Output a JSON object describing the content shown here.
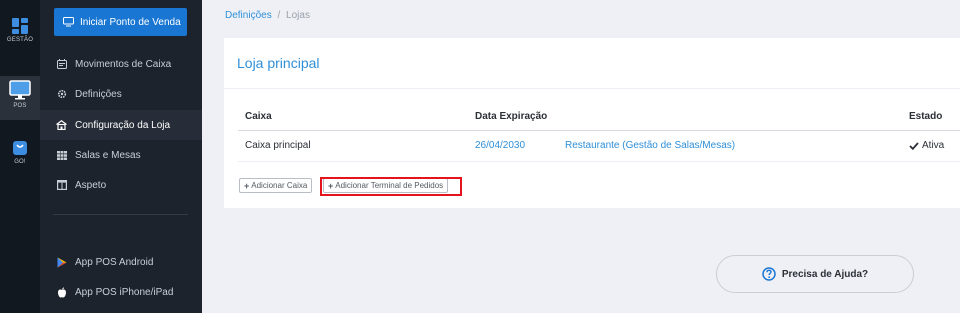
{
  "rail": {
    "items": [
      {
        "label": "GESTÃO",
        "icon": "dashboard-icon"
      },
      {
        "label": "POS",
        "icon": "monitor-icon"
      },
      {
        "label": "GO!",
        "icon": "shopping-bag-icon"
      }
    ]
  },
  "sidebar": {
    "pdv_button": "Iniciar Ponto de Venda",
    "items": [
      {
        "label": "Movimentos de Caixa",
        "icon": "cash-register-icon"
      },
      {
        "label": "Definições",
        "icon": "gear-icon"
      },
      {
        "label": "Configuração da Loja",
        "icon": "store-icon"
      },
      {
        "label": "Salas e Mesas",
        "icon": "grid-icon"
      },
      {
        "label": "Aspeto",
        "icon": "layout-icon"
      }
    ],
    "apps": [
      {
        "label": "App POS Android",
        "icon": "google-play-icon"
      },
      {
        "label": "App POS iPhone/iPad",
        "icon": "apple-icon"
      }
    ]
  },
  "breadcrumb": {
    "parent": "Definições",
    "separator": "/",
    "current": "Lojas"
  },
  "card": {
    "title": "Loja principal",
    "columns": {
      "caixa": "Caixa",
      "data": "Data Expiração",
      "estado": "Estado"
    },
    "rows": [
      {
        "caixa": "Caixa principal",
        "data": "26/04/2030",
        "tipo": "Restaurante (Gestão de Salas/Mesas)",
        "estado": "Ativa"
      }
    ],
    "add_caixa": "Adicionar Caixa",
    "add_terminal": "Adicionar Terminal de Pedidos"
  },
  "help": {
    "label": "Precisa de Ajuda?"
  },
  "colors": {
    "accent": "#2f8fd8",
    "button": "#1976d2",
    "highlight": "#e3141b"
  }
}
